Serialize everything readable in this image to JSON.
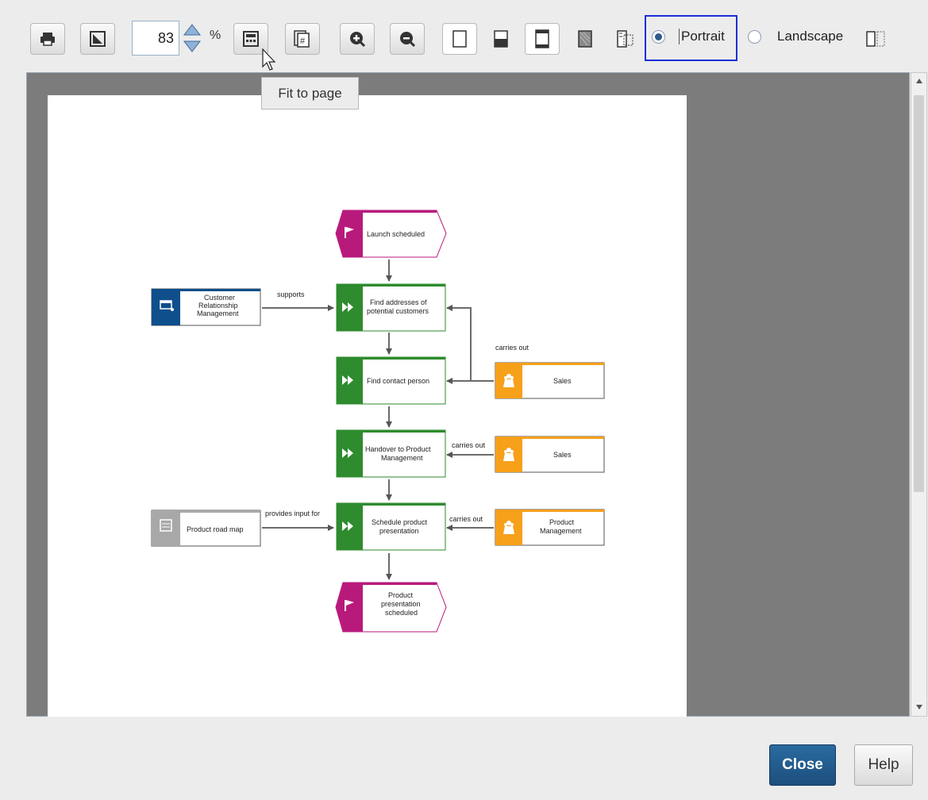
{
  "toolbar": {
    "buttons": [
      "print-icon",
      "page-setup-icon",
      "fit-to-page-icon",
      "page-numbering-icon",
      "zoom-in-icon",
      "zoom-out-icon",
      "blank-page-icon",
      "header-footer-icon",
      "page-border-icon",
      "background-pattern-icon",
      "print-grid-icon",
      "page-split-icon"
    ],
    "zoom_value": "83",
    "zoom_unit": "%",
    "orientation": {
      "portrait_label": "Portrait",
      "landscape_label": "Landscape",
      "selected": "portrait"
    }
  },
  "tooltip": "Fit to page",
  "diagram": {
    "nodes": [
      {
        "id": "launch",
        "type": "event",
        "label": "Launch scheduled"
      },
      {
        "id": "find-addresses",
        "type": "function",
        "label": "Find addresses of potential customers"
      },
      {
        "id": "find-contact",
        "type": "function",
        "label": "Find contact person"
      },
      {
        "id": "handover",
        "type": "function",
        "label": "Handover to Product Management"
      },
      {
        "id": "schedule",
        "type": "function",
        "label": "Schedule product presentation"
      },
      {
        "id": "presentation",
        "type": "event",
        "label": "Product presentation scheduled"
      },
      {
        "id": "crm",
        "type": "system",
        "label": "Customer Relationship Management"
      },
      {
        "id": "roadmap",
        "type": "document",
        "label": "Product road map"
      },
      {
        "id": "sales1",
        "type": "org",
        "label": "Sales"
      },
      {
        "id": "sales2",
        "type": "org",
        "label": "Sales"
      },
      {
        "id": "pm",
        "type": "org",
        "label": "Product Management"
      }
    ],
    "edge_labels": {
      "supports": "supports",
      "carries_out_1": "carries out",
      "carries_out_2": "carries out",
      "carries_out_3": "carries out",
      "provides_input": "provides input for"
    }
  },
  "dialog": {
    "close_label": "Close",
    "help_label": "Help"
  },
  "colors": {
    "event": "#b81a7c",
    "function": "#2e8b2e",
    "system": "#0e4f8c",
    "org": "#f7a01a",
    "document": "#a8a8a8",
    "focus": "#1a2fd6",
    "primary_button": "#1d5585"
  }
}
